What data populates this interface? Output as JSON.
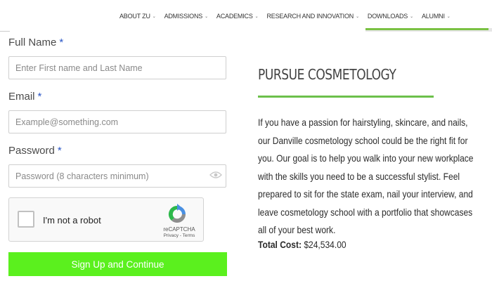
{
  "nav": {
    "items": [
      {
        "label": "ABOUT ZU"
      },
      {
        "label": "ADMISSIONS"
      },
      {
        "label": "ACADEMICS"
      },
      {
        "label": "RESEARCH AND INNOVATION"
      },
      {
        "label": "DOWNLOADS"
      },
      {
        "label": "ALUMNI"
      }
    ]
  },
  "form": {
    "full_name_label": "Full Name",
    "full_name_placeholder": "Enter First name and Last Name",
    "email_label": "Email",
    "email_placeholder": "Example@something.com",
    "password_label": "Password",
    "password_placeholder": "Password (8 characters minimum)",
    "required_mark": "*",
    "captcha_text": "I'm not a robot",
    "captcha_brand": "reCAPTCHA",
    "captcha_terms": "Privacy - Terms",
    "submit_label": "Sign Up and Continue"
  },
  "content": {
    "heading": "PURSUE COSMETOLOGY",
    "paragraph": "If you have a passion for hairstyling, skincare, and nails, our Danville cosmetology school could be the right fit for you. Our goal is to help you walk into your new workplace with the skills you need to be a successful stylist. Feel prepared to sit for the state exam, nail your interview, and leave cosmetology school with a portfolio that showcases all of your best work.",
    "cost_label": "Total Cost:",
    "cost_value": "$24,534.00"
  },
  "colors": {
    "accent_green": "#6cc04a",
    "button_green": "#5bf01e",
    "required_blue": "#2a56c6"
  },
  "icons": [
    "chevron-down-icon",
    "eye-icon",
    "recaptcha-logo-icon",
    "checkbox-icon"
  ]
}
